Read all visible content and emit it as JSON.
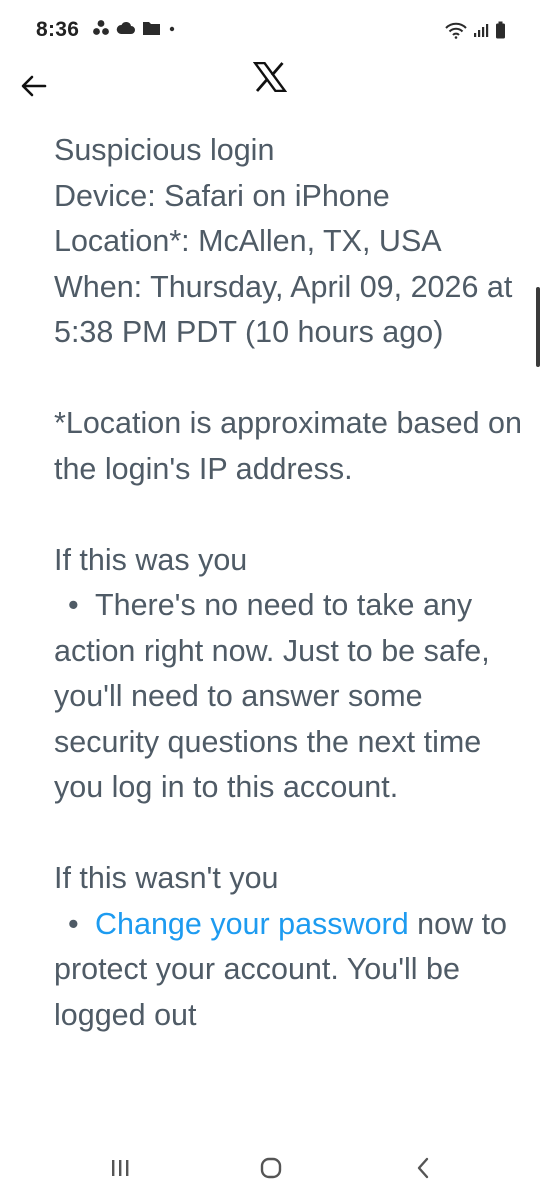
{
  "status_bar": {
    "time": "8:36",
    "left_icons": [
      "pinwheel-icon",
      "cloud-icon",
      "folder-icon",
      "dot-icon"
    ],
    "right_icons": [
      "wifi-icon",
      "signal-icon",
      "battery-icon"
    ]
  },
  "header": {
    "back_icon": "arrow-left-icon",
    "logo_icon": "x-logo-icon"
  },
  "email": {
    "line1": "Suspicious login",
    "line2": "Device: Safari on iPhone",
    "line3": "Location*: McAllen, TX, USA",
    "line4": "When: Thursday, April 09, 2026 at 5:38 PM PDT (10 hours ago)",
    "note": "*Location is approximate based on the login's IP address.",
    "if_you_heading": "If this was you",
    "bullet_char": "•",
    "if_you_text": "There's no need to take any action right now. Just to be safe, you'll need to answer some security questions the next time you log in to this account.",
    "if_not_heading": "If this wasn't you",
    "change_password_link": "Change your password",
    "if_not_text": "now to protect your account. You'll be logged out"
  },
  "nav_bar": {
    "icons": [
      "recents-icon",
      "home-icon",
      "back-chevron-icon"
    ]
  },
  "colors": {
    "body_text": "#4f5b66",
    "link": "#1d9bf0",
    "status_text": "#222222"
  }
}
